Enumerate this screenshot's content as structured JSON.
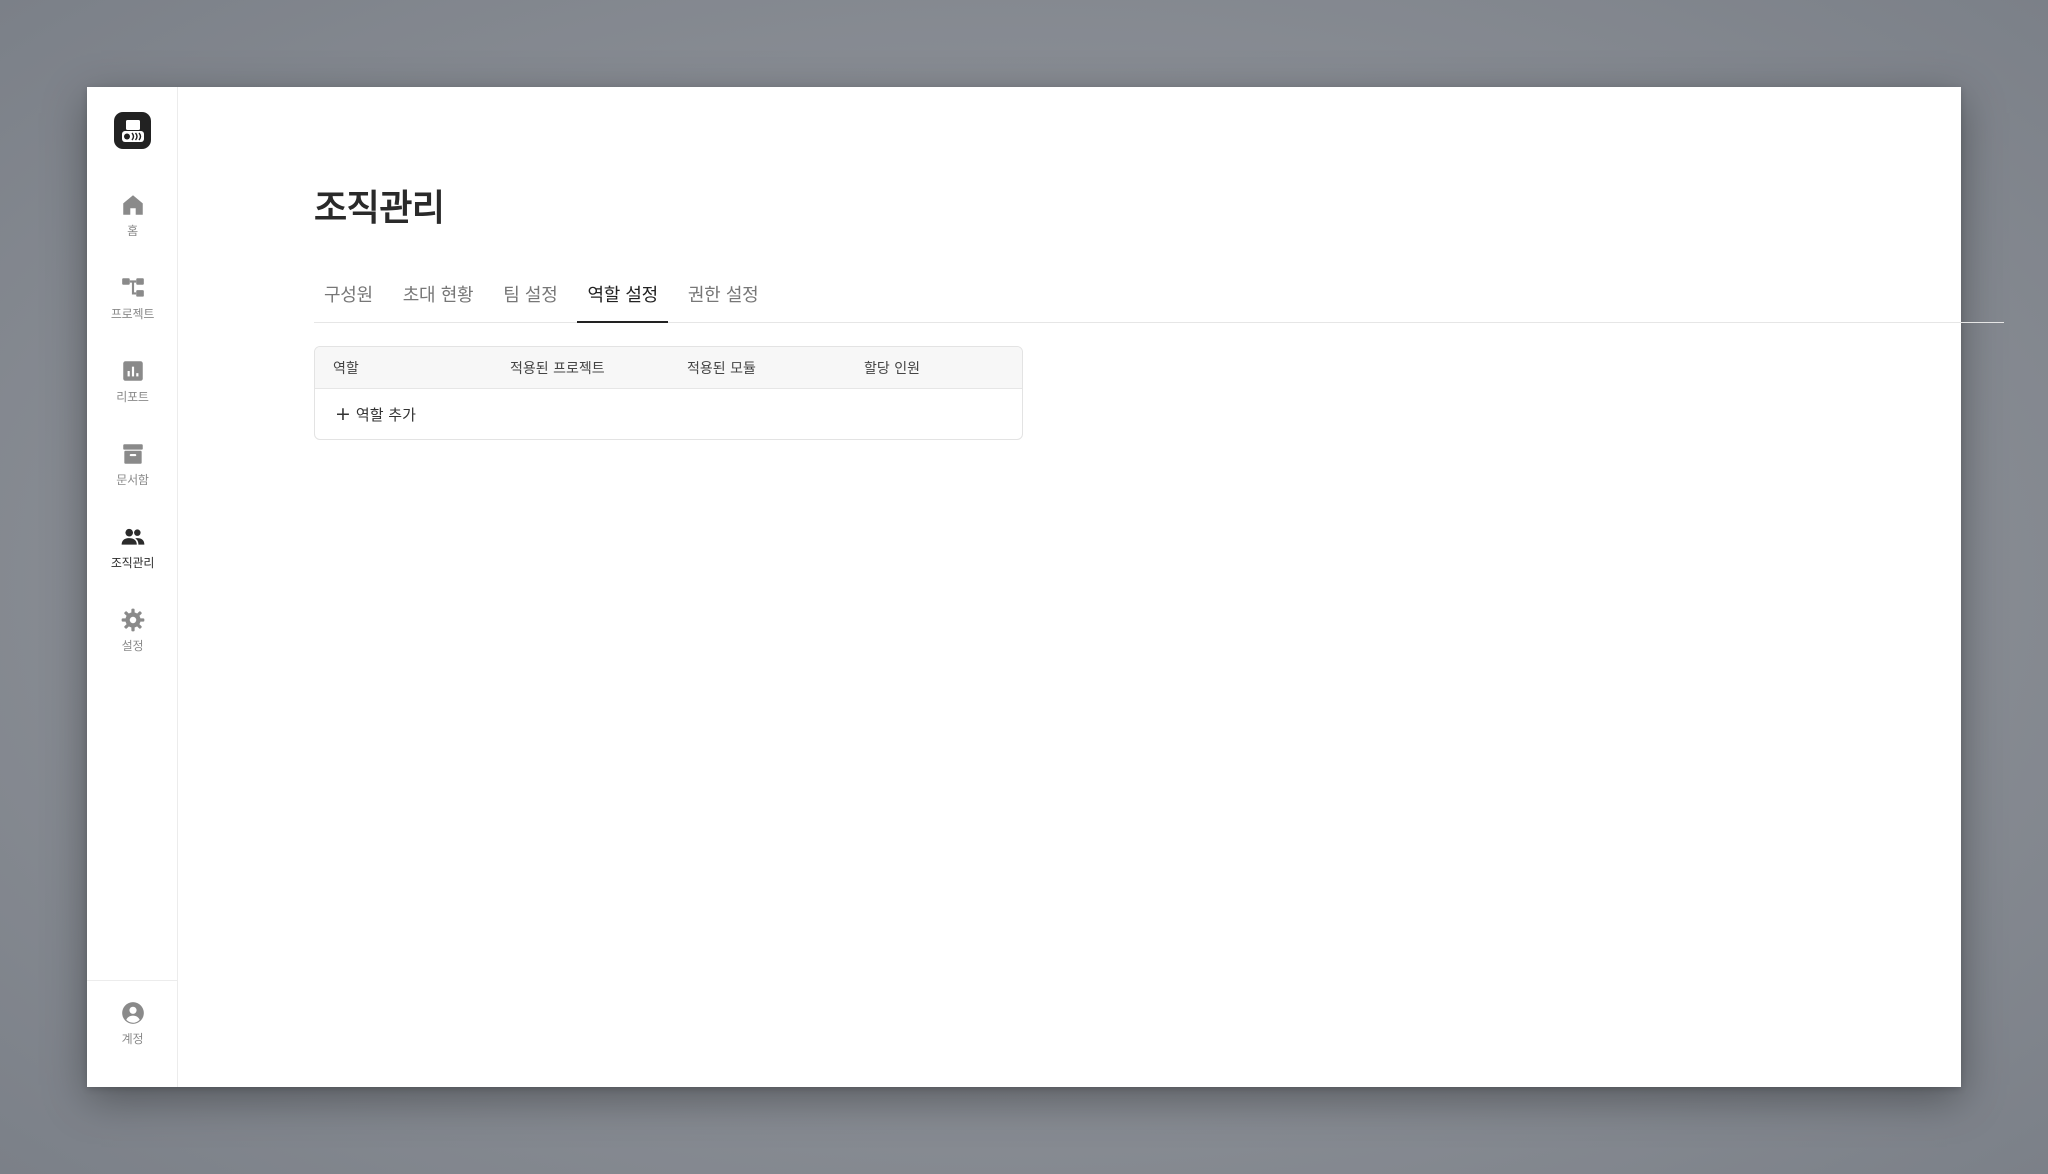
{
  "sidebar": {
    "items": [
      {
        "label": "홈",
        "icon": "home-icon"
      },
      {
        "label": "프로젝트",
        "icon": "project-tree-icon"
      },
      {
        "label": "리포트",
        "icon": "report-chart-icon"
      },
      {
        "label": "문서함",
        "icon": "archive-box-icon"
      },
      {
        "label": "조직관리",
        "icon": "people-group-icon",
        "active": true
      },
      {
        "label": "설정",
        "icon": "gear-icon"
      }
    ],
    "account": {
      "label": "계정",
      "icon": "account-circle-icon"
    }
  },
  "main": {
    "title": "조직관리",
    "tabs": [
      {
        "label": "구성원"
      },
      {
        "label": "초대 현황"
      },
      {
        "label": "팀 설정"
      },
      {
        "label": "역할 설정",
        "active": true
      },
      {
        "label": "권한 설정"
      }
    ],
    "table": {
      "columns": [
        "역할",
        "적용된 프로젝트",
        "적용된 모듈",
        "할당 인원"
      ],
      "add_label": "역할 추가"
    }
  },
  "colors": {
    "accent": "#222222",
    "inactive": "#8a8a8a",
    "backdrop": "#8a8e95"
  }
}
